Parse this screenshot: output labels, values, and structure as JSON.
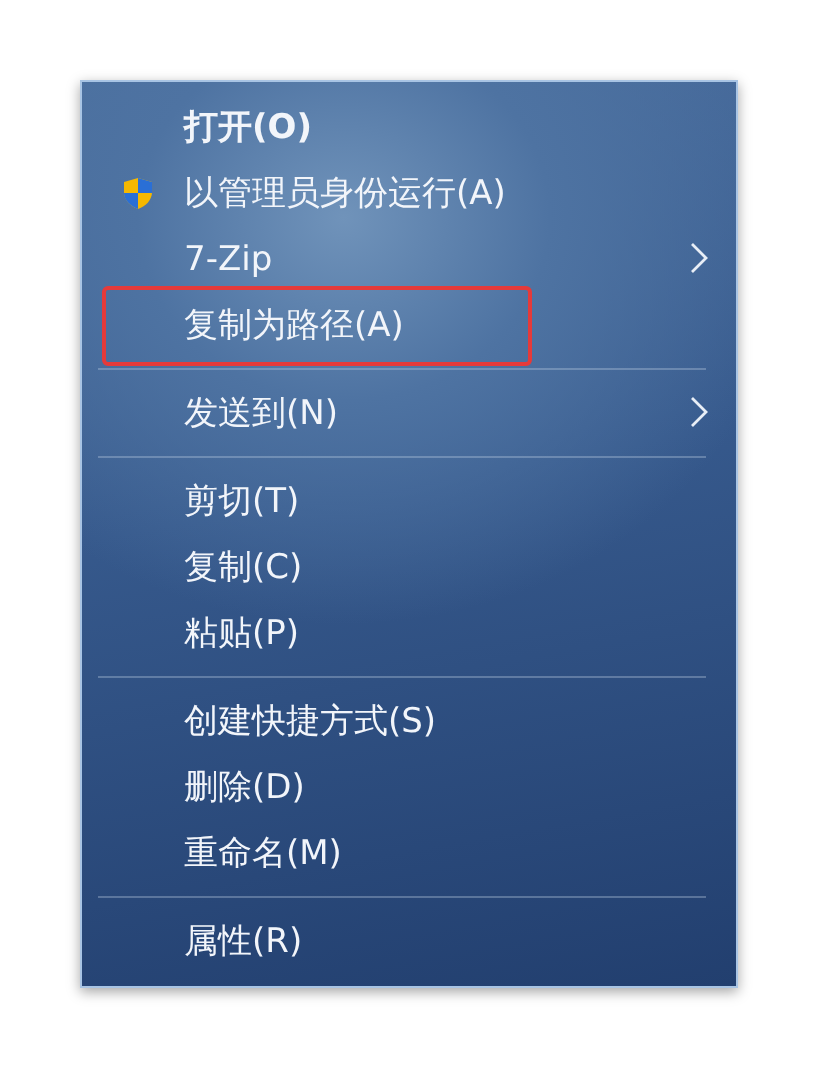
{
  "menu": {
    "items": [
      {
        "kind": "item",
        "label": "打开(O)",
        "bold": true,
        "submenu": false,
        "highlighted": false
      },
      {
        "kind": "shield-item",
        "label": "以管理员身份运行(A)",
        "bold": false,
        "submenu": false,
        "highlighted": false
      },
      {
        "kind": "item",
        "label": "7-Zip",
        "bold": false,
        "submenu": true,
        "highlighted": false
      },
      {
        "kind": "item",
        "label": "复制为路径(A)",
        "bold": false,
        "submenu": false,
        "highlighted": true
      },
      {
        "kind": "separator"
      },
      {
        "kind": "item",
        "label": "发送到(N)",
        "bold": false,
        "submenu": true,
        "highlighted": false
      },
      {
        "kind": "separator"
      },
      {
        "kind": "item",
        "label": "剪切(T)",
        "bold": false,
        "submenu": false,
        "highlighted": false
      },
      {
        "kind": "item",
        "label": "复制(C)",
        "bold": false,
        "submenu": false,
        "highlighted": false
      },
      {
        "kind": "item",
        "label": "粘贴(P)",
        "bold": false,
        "submenu": false,
        "highlighted": false
      },
      {
        "kind": "separator"
      },
      {
        "kind": "item",
        "label": "创建快捷方式(S)",
        "bold": false,
        "submenu": false,
        "highlighted": false
      },
      {
        "kind": "item",
        "label": "删除(D)",
        "bold": false,
        "submenu": false,
        "highlighted": false
      },
      {
        "kind": "item",
        "label": "重命名(M)",
        "bold": false,
        "submenu": false,
        "highlighted": false
      },
      {
        "kind": "separator"
      },
      {
        "kind": "item",
        "label": "属性(R)",
        "bold": false,
        "submenu": false,
        "highlighted": false
      }
    ]
  }
}
